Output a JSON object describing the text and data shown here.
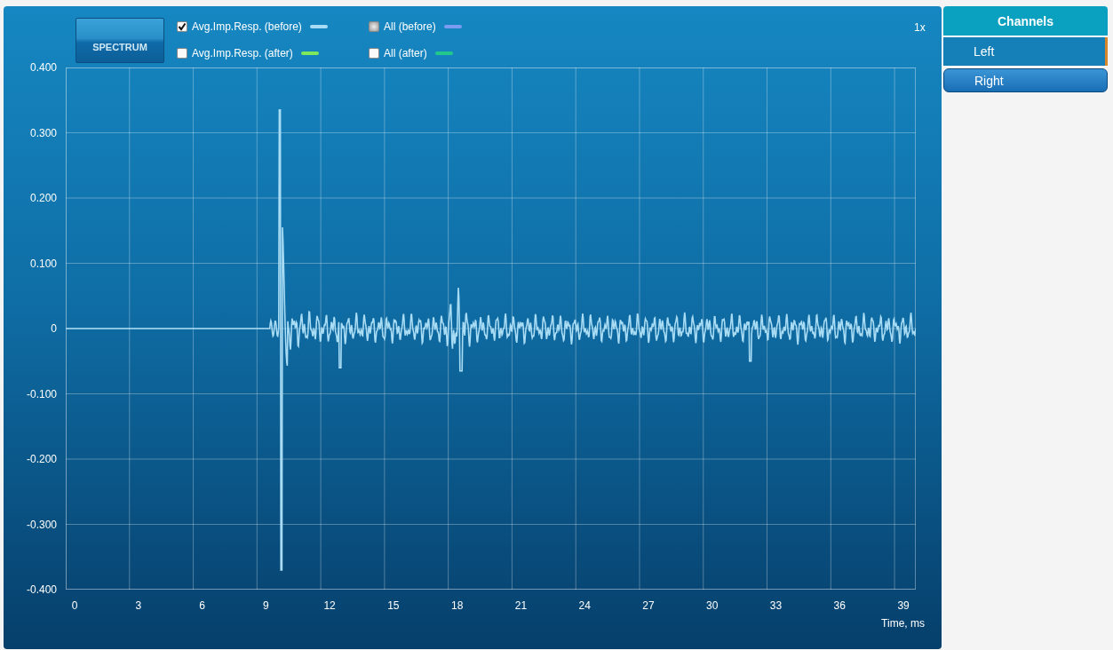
{
  "spectrum_button": {
    "label": "SPECTRUM"
  },
  "legend": [
    {
      "label": "Avg.Imp.Resp. (before)",
      "checked": true,
      "disabled": false,
      "color": "#a8dcf5"
    },
    {
      "label": "All (before)",
      "checked": false,
      "disabled": true,
      "color": "#7b9cf0"
    },
    {
      "label": "Avg.Imp.Resp. (after)",
      "checked": false,
      "disabled": false,
      "color": "#7de85a"
    },
    {
      "label": "All (after)",
      "checked": false,
      "disabled": false,
      "color": "#22c88a"
    }
  ],
  "zoom_label": "1x",
  "y_axis_labels": [
    "0.400",
    "0.300",
    "0.200",
    "0.100",
    "0",
    "-0.100",
    "-0.200",
    "-0.300",
    "-0.400"
  ],
  "x_axis_labels": [
    "0",
    "3",
    "6",
    "9",
    "12",
    "15",
    "18",
    "21",
    "24",
    "27",
    "30",
    "33",
    "36",
    "39"
  ],
  "x_axis_title": "Time, ms",
  "channels": {
    "title": "Channels",
    "items": [
      {
        "label": "Left",
        "selected": true
      },
      {
        "label": "Right",
        "selected": false
      }
    ]
  }
}
